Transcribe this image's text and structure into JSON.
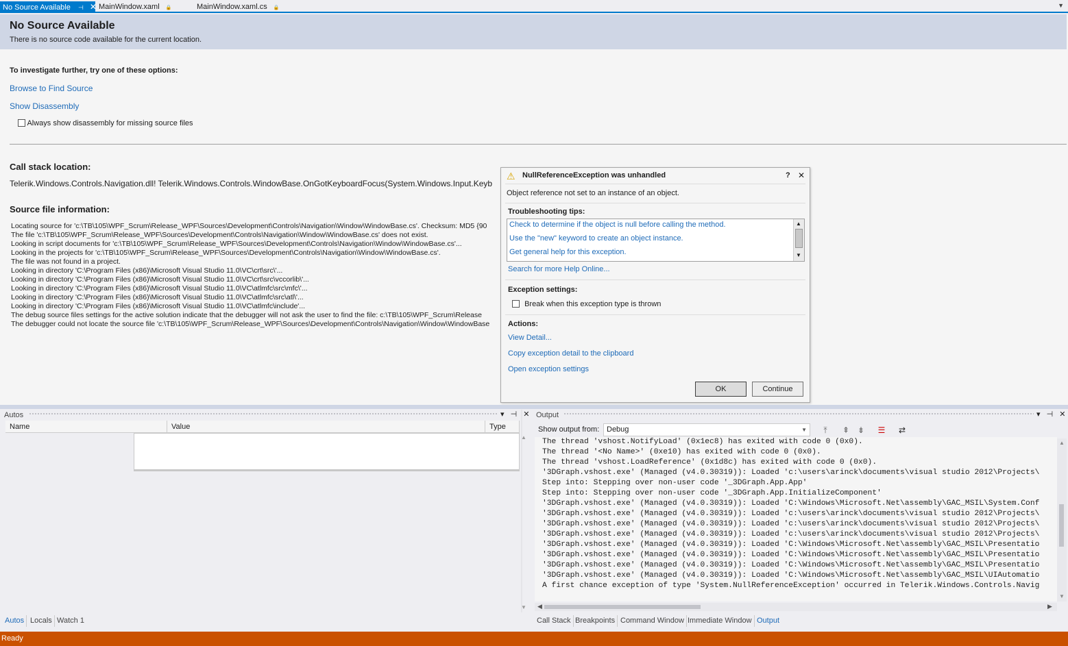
{
  "tabs": [
    {
      "label": "No Source Available",
      "pin": "⊣",
      "close": "✕"
    },
    {
      "label": "MainWindow.xaml",
      "lock": "🔒"
    },
    {
      "label": "MainWindow.xaml.cs",
      "lock": "🔒"
    }
  ],
  "tab_overflow": "▼",
  "doc": {
    "title": "No Source Available",
    "subtitle": "There is no source code available for the current location.",
    "investigate_heading": "To investigate further, try one of these options:",
    "browse_link": "Browse to Find Source",
    "disassembly_link": "Show Disassembly",
    "always_show_label": "Always show disassembly for missing source files",
    "callstack_heading": "Call stack location:",
    "callstack_text": "Telerik.Windows.Controls.Navigation.dll! Telerik.Windows.Controls.WindowBase.OnGotKeyboardFocus(System.Windows.Input.Keyb",
    "sourceinfo_heading": "Source file information:",
    "sourceinfo_lines": [
      "Locating source for 'c:\\TB\\105\\WPF_Scrum\\Release_WPF\\Sources\\Development\\Controls\\Navigation\\Window\\WindowBase.cs'. Checksum: MD5 {90",
      "The file 'c:\\TB\\105\\WPF_Scrum\\Release_WPF\\Sources\\Development\\Controls\\Navigation\\Window\\WindowBase.cs' does not exist.",
      "Looking in script documents for 'c:\\TB\\105\\WPF_Scrum\\Release_WPF\\Sources\\Development\\Controls\\Navigation\\Window\\WindowBase.cs'...",
      "Looking in the projects for 'c:\\TB\\105\\WPF_Scrum\\Release_WPF\\Sources\\Development\\Controls\\Navigation\\Window\\WindowBase.cs'.",
      "The file was not found in a project.",
      "Looking in directory 'C:\\Program Files (x86)\\Microsoft Visual Studio 11.0\\VC\\crt\\src\\'...",
      "Looking in directory 'C:\\Program Files (x86)\\Microsoft Visual Studio 11.0\\VC\\crt\\src\\vccorlib\\'...",
      "Looking in directory 'C:\\Program Files (x86)\\Microsoft Visual Studio 11.0\\VC\\atlmfc\\src\\mfc\\'...",
      "Looking in directory 'C:\\Program Files (x86)\\Microsoft Visual Studio 11.0\\VC\\atlmfc\\src\\atl\\'...",
      "Looking in directory 'C:\\Program Files (x86)\\Microsoft Visual Studio 11.0\\VC\\atlmfc\\include'...",
      "The debug source files settings for the active solution indicate that the debugger will not ask the user to find the file: c:\\TB\\105\\WPF_Scrum\\Release",
      "The debugger could not locate the source file 'c:\\TB\\105\\WPF_Scrum\\Release_WPF\\Sources\\Development\\Controls\\Navigation\\Window\\WindowBase"
    ]
  },
  "exception": {
    "title": "NullReferenceException was unhandled",
    "warning_icon": "⚠",
    "help_btn": "?",
    "close_btn": "✕",
    "message": "Object reference not set to an instance of an object.",
    "tips_heading": "Troubleshooting tips:",
    "tips": [
      "Check to determine if the object is null before calling the method.",
      "Use the \"new\" keyword to create an object instance.",
      "Get general help for this exception."
    ],
    "search_link": "Search for more Help Online...",
    "settings_heading": "Exception settings:",
    "break_label": "Break when this exception type is thrown",
    "actions_heading": "Actions:",
    "actions": [
      "View Detail...",
      "Copy exception detail to the clipboard",
      "Open exception settings"
    ],
    "ok_label": "OK",
    "continue_label": "Continue"
  },
  "autos": {
    "title": "Autos",
    "buttons": "▾ ⊣ ✕",
    "columns": [
      "Name",
      "Value",
      "Type"
    ]
  },
  "output": {
    "title": "Output",
    "buttons": "▾ ⊣ ✕",
    "show_from_label": "Show output from:",
    "show_from_value": "Debug",
    "lines": [
      "The thread 'vshost.NotifyLoad' (0x1ec8) has exited with code 0 (0x0).",
      "The thread '<No Name>' (0xe10) has exited with code 0 (0x0).",
      "The thread 'vshost.LoadReference' (0x1d8c) has exited with code 0 (0x0).",
      "'3DGraph.vshost.exe' (Managed (v4.0.30319)): Loaded 'c:\\users\\arinck\\documents\\visual studio 2012\\Projects\\",
      "Step into: Stepping over non-user code '_3DGraph.App.App'",
      "Step into: Stepping over non-user code '_3DGraph.App.InitializeComponent'",
      "'3DGraph.vshost.exe' (Managed (v4.0.30319)): Loaded 'C:\\Windows\\Microsoft.Net\\assembly\\GAC_MSIL\\System.Conf",
      "'3DGraph.vshost.exe' (Managed (v4.0.30319)): Loaded 'c:\\users\\arinck\\documents\\visual studio 2012\\Projects\\",
      "'3DGraph.vshost.exe' (Managed (v4.0.30319)): Loaded 'c:\\users\\arinck\\documents\\visual studio 2012\\Projects\\",
      "'3DGraph.vshost.exe' (Managed (v4.0.30319)): Loaded 'c:\\users\\arinck\\documents\\visual studio 2012\\Projects\\",
      "'3DGraph.vshost.exe' (Managed (v4.0.30319)): Loaded 'C:\\Windows\\Microsoft.Net\\assembly\\GAC_MSIL\\Presentatio",
      "'3DGraph.vshost.exe' (Managed (v4.0.30319)): Loaded 'C:\\Windows\\Microsoft.Net\\assembly\\GAC_MSIL\\Presentatio",
      "'3DGraph.vshost.exe' (Managed (v4.0.30319)): Loaded 'C:\\Windows\\Microsoft.Net\\assembly\\GAC_MSIL\\Presentatio",
      "'3DGraph.vshost.exe' (Managed (v4.0.30319)): Loaded 'C:\\Windows\\Microsoft.Net\\assembly\\GAC_MSIL\\UIAutomatio",
      "A first chance exception of type 'System.NullReferenceException' occurred in Telerik.Windows.Controls.Navig"
    ]
  },
  "bottom_tabs_left": [
    "Autos",
    "Locals",
    "Watch 1"
  ],
  "bottom_tabs_right": [
    "Call Stack",
    "Breakpoints",
    "Command Window",
    "Immediate Window",
    "Output"
  ],
  "status": "Ready",
  "colors": {
    "accent": "#007acc",
    "status": "#ca5100",
    "link": "#1e6bb8"
  }
}
